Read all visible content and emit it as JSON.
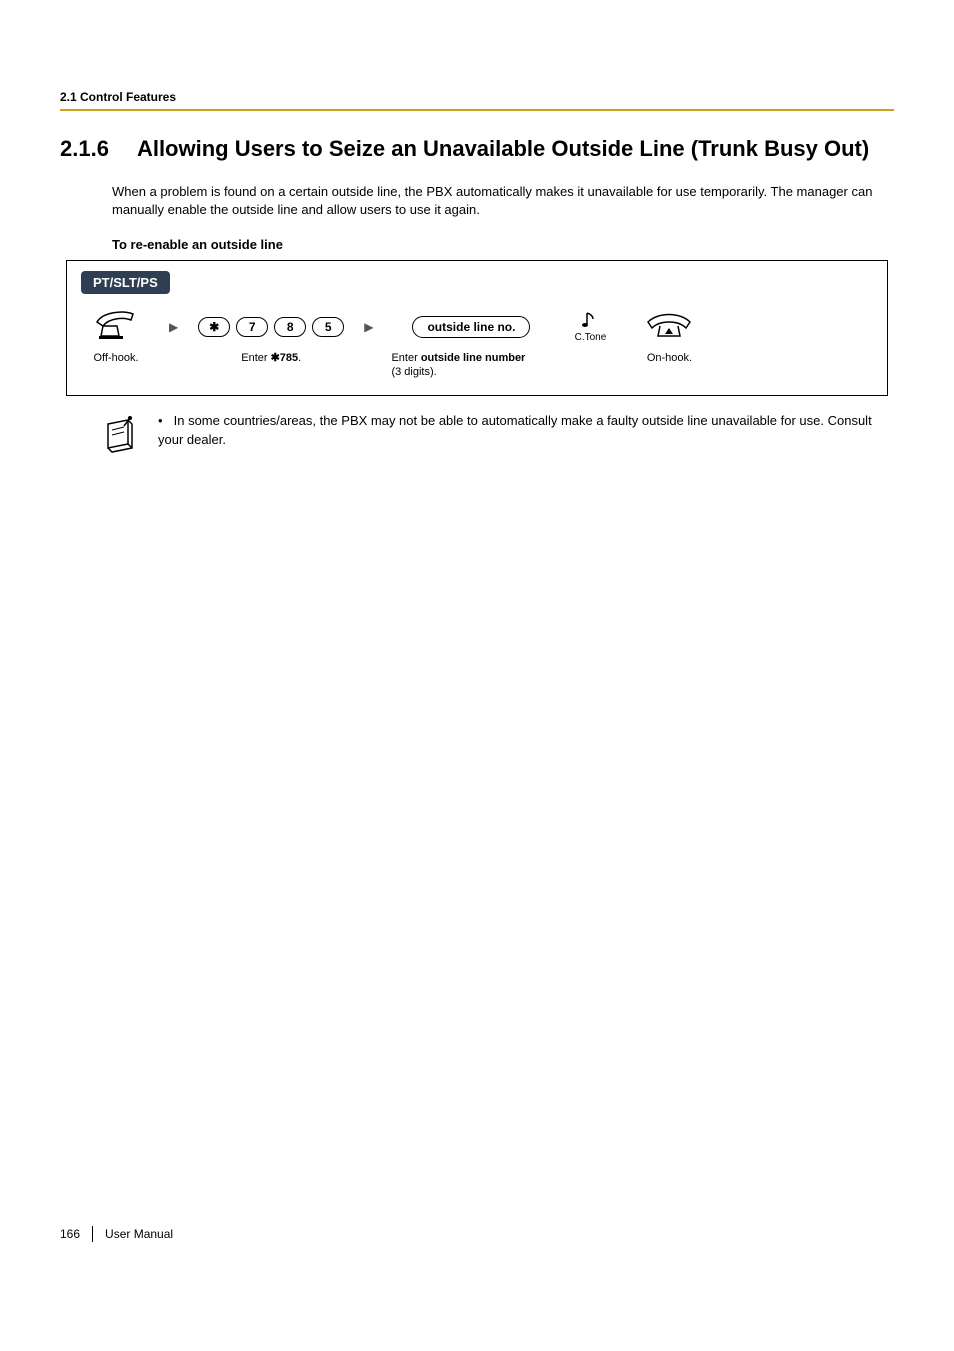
{
  "running_head": "2.1 Control Features",
  "section": {
    "num": "2.1.6",
    "title": "Allowing Users to Seize an Unavailable Outside Line (Trunk Busy Out)"
  },
  "intro": "When a problem is found on a certain outside line, the PBX automatically makes it unavailable for use temporarily. The manager can manually enable the outside line and allow users to use it again.",
  "subhead": "To re-enable an outside line",
  "proc": {
    "tab": "PT/SLT/PS",
    "offhook_label": "Off-hook.",
    "key_star": "✱",
    "key_7": "7",
    "key_8": "8",
    "key_5": "5",
    "enter785": {
      "prefix": "Enter ",
      "code": "✱785",
      "suffix": "."
    },
    "field_label": "outside line no.",
    "enter_outside": {
      "line1_a": "Enter ",
      "line1_b": "outside line number",
      "line2": "(3 digits)."
    },
    "ctone": "C.Tone",
    "onhook_label": "On-hook."
  },
  "note": "In some countries/areas, the PBX may not be able to automatically make a faulty outside line unavailable for use. Consult your dealer.",
  "footer": {
    "page": "166",
    "label": "User Manual"
  }
}
